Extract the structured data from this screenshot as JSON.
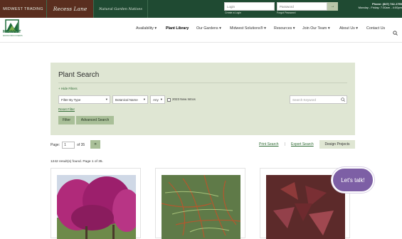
{
  "topbar": {
    "brands": [
      "MIDWEST TRADING",
      "Recess Lane",
      "Natural Garden Natives"
    ],
    "login_placeholder": "Login",
    "password_placeholder": "Password",
    "go_label": "→",
    "create_login": "Create a Login",
    "forgot_password": "Forgot Password",
    "phone": "Phone: (847) 742-1790",
    "hours": "Monday - Friday: 7:30am - 4:00pm"
  },
  "logo": {
    "name": "MIDWEST",
    "tagline": "GROUNDCOVERS"
  },
  "nav": {
    "items": [
      "Availability ▾",
      "Plant Library",
      "Our Gardens ▾",
      "Midwest Solutions® ▾",
      "Resources ▾",
      "Join Our Team ▾",
      "About Us ▾",
      "Contact Us"
    ],
    "active": "Plant Library",
    "search_icon": "search-icon"
  },
  "search_panel": {
    "title": "Plant Search",
    "hide_filters": "+ Hide Filters",
    "filter_type": "Filter By Type",
    "sort_by": "Botanical Name",
    "any": "Any",
    "new_intros_label": "2023 New Intros",
    "keyword_placeholder": "Search Keyword",
    "reset_filter": "Reset Filter",
    "filter_button": "Filter",
    "advanced_button": "Advanced Search"
  },
  "pagination": {
    "label": "Page:",
    "current_page": "1",
    "of_label": "of 35",
    "next_label": "»"
  },
  "actions": {
    "print": "Print Search",
    "export": "Export Search",
    "separator": "|",
    "design": "Design Projects"
  },
  "results_text": "1242 result(s) found. Page 1 of 35.",
  "chat_label": "Let's talk!",
  "colors": {
    "header_green": "#1f4a32",
    "panel_bg": "#dfe6d3",
    "button_green": "#a9bf98",
    "chat_purple": "#7d5fa5"
  }
}
